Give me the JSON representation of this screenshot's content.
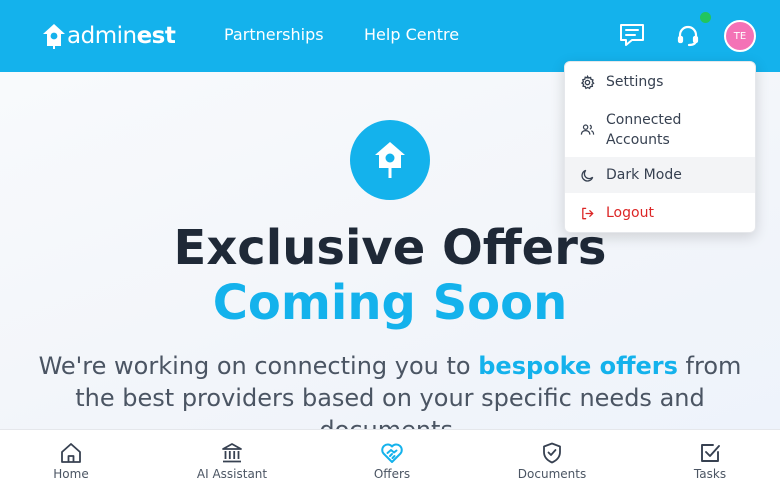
{
  "header": {
    "logo_text_light": "admin",
    "logo_text_bold": "est",
    "nav": [
      "Partnerships",
      "Help Centre"
    ],
    "avatar_initials": "TE",
    "icons": [
      "message-icon",
      "headset-icon"
    ]
  },
  "dropdown": {
    "items": [
      {
        "label": "Settings",
        "icon": "gear-icon"
      },
      {
        "label": "Connected Accounts",
        "icon": "users-icon"
      },
      {
        "label": "Dark Mode",
        "icon": "moon-icon"
      },
      {
        "label": "Logout",
        "icon": "logout-icon"
      }
    ]
  },
  "hero": {
    "icon": "birdhouse-icon",
    "title_line1": "Exclusive Offers",
    "title_line2": "Coming Soon",
    "desc_before": "We're working on connecting you to ",
    "desc_highlight": "bespoke offers",
    "desc_after": " from the best providers based on your specific needs and documents."
  },
  "bottom_nav": [
    {
      "label": "Home",
      "icon": "home-icon"
    },
    {
      "label": "AI Assistant",
      "icon": "bank-icon"
    },
    {
      "label": "Offers",
      "icon": "heart-handshake-icon",
      "active": true
    },
    {
      "label": "Documents",
      "icon": "shield-check-icon"
    },
    {
      "label": "Tasks",
      "icon": "checkbox-icon"
    }
  ],
  "colors": {
    "brand": "#14b2ec",
    "dark_text": "#1f2937",
    "danger": "#dc2626",
    "status_online": "#22c55e",
    "avatar": "#f472b6"
  }
}
